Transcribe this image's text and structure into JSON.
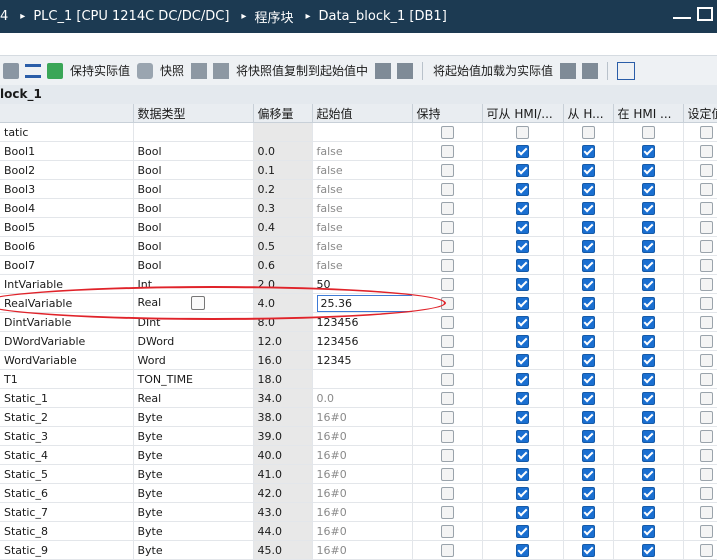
{
  "title": {
    "prefix": "4",
    "plc": "PLC_1 [CPU 1214C DC/DC/DC]",
    "blocks": "程序块",
    "block": "Data_block_1 [DB1]"
  },
  "toolbar": {
    "keep_actual": "保持实际值",
    "snapshot": "快照",
    "copy_snapshot": "将快照值复制到起始值中",
    "load_start": "将起始值加载为实际值"
  },
  "block_name": "lock_1",
  "columns": {
    "name": "",
    "datatype": "数据类型",
    "offset": "偏移量",
    "start": "起始值",
    "retain": "保持",
    "hmi_access": "可从 HMI/...",
    "hmi_from": "从 H...",
    "hmi_visible": "在 HMI ...",
    "setpoint": "设定值"
  },
  "static_header": "tatic",
  "rows": [
    {
      "name": "Bool1",
      "type": "Bool",
      "offset": "0.0",
      "start": "false"
    },
    {
      "name": "Bool2",
      "type": "Bool",
      "offset": "0.1",
      "start": "false"
    },
    {
      "name": "Bool3",
      "type": "Bool",
      "offset": "0.2",
      "start": "false"
    },
    {
      "name": "Bool4",
      "type": "Bool",
      "offset": "0.3",
      "start": "false"
    },
    {
      "name": "Bool5",
      "type": "Bool",
      "offset": "0.4",
      "start": "false"
    },
    {
      "name": "Bool6",
      "type": "Bool",
      "offset": "0.5",
      "start": "false"
    },
    {
      "name": "Bool7",
      "type": "Bool",
      "offset": "0.6",
      "start": "false"
    },
    {
      "name": "IntVariable",
      "type": "Int",
      "offset": "2.0",
      "start": "50"
    },
    {
      "name": "RealVariable",
      "type": "Real",
      "offset": "4.0",
      "start": "25.36"
    },
    {
      "name": "DintVariable",
      "type": "DInt",
      "offset": "8.0",
      "start": "123456"
    },
    {
      "name": "DWordVariable",
      "type": "DWord",
      "offset": "12.0",
      "start": "123456"
    },
    {
      "name": "WordVariable",
      "type": "Word",
      "offset": "16.0",
      "start": "12345"
    },
    {
      "name": "T1",
      "type": "TON_TIME",
      "offset": "18.0",
      "start": ""
    },
    {
      "name": "Static_1",
      "type": "Real",
      "offset": "34.0",
      "start": "0.0"
    },
    {
      "name": "Static_2",
      "type": "Byte",
      "offset": "38.0",
      "start": "16#0"
    },
    {
      "name": "Static_3",
      "type": "Byte",
      "offset": "39.0",
      "start": "16#0"
    },
    {
      "name": "Static_4",
      "type": "Byte",
      "offset": "40.0",
      "start": "16#0"
    },
    {
      "name": "Static_5",
      "type": "Byte",
      "offset": "41.0",
      "start": "16#0"
    },
    {
      "name": "Static_6",
      "type": "Byte",
      "offset": "42.0",
      "start": "16#0"
    },
    {
      "name": "Static_7",
      "type": "Byte",
      "offset": "43.0",
      "start": "16#0"
    },
    {
      "name": "Static_8",
      "type": "Byte",
      "offset": "44.0",
      "start": "16#0"
    },
    {
      "name": "Static_9",
      "type": "Byte",
      "offset": "45.0",
      "start": "16#0"
    }
  ],
  "colors": {
    "title_bg": "#1c3a52",
    "checkbox_on": "#1a6fd1",
    "highlight": "#e0232a"
  }
}
